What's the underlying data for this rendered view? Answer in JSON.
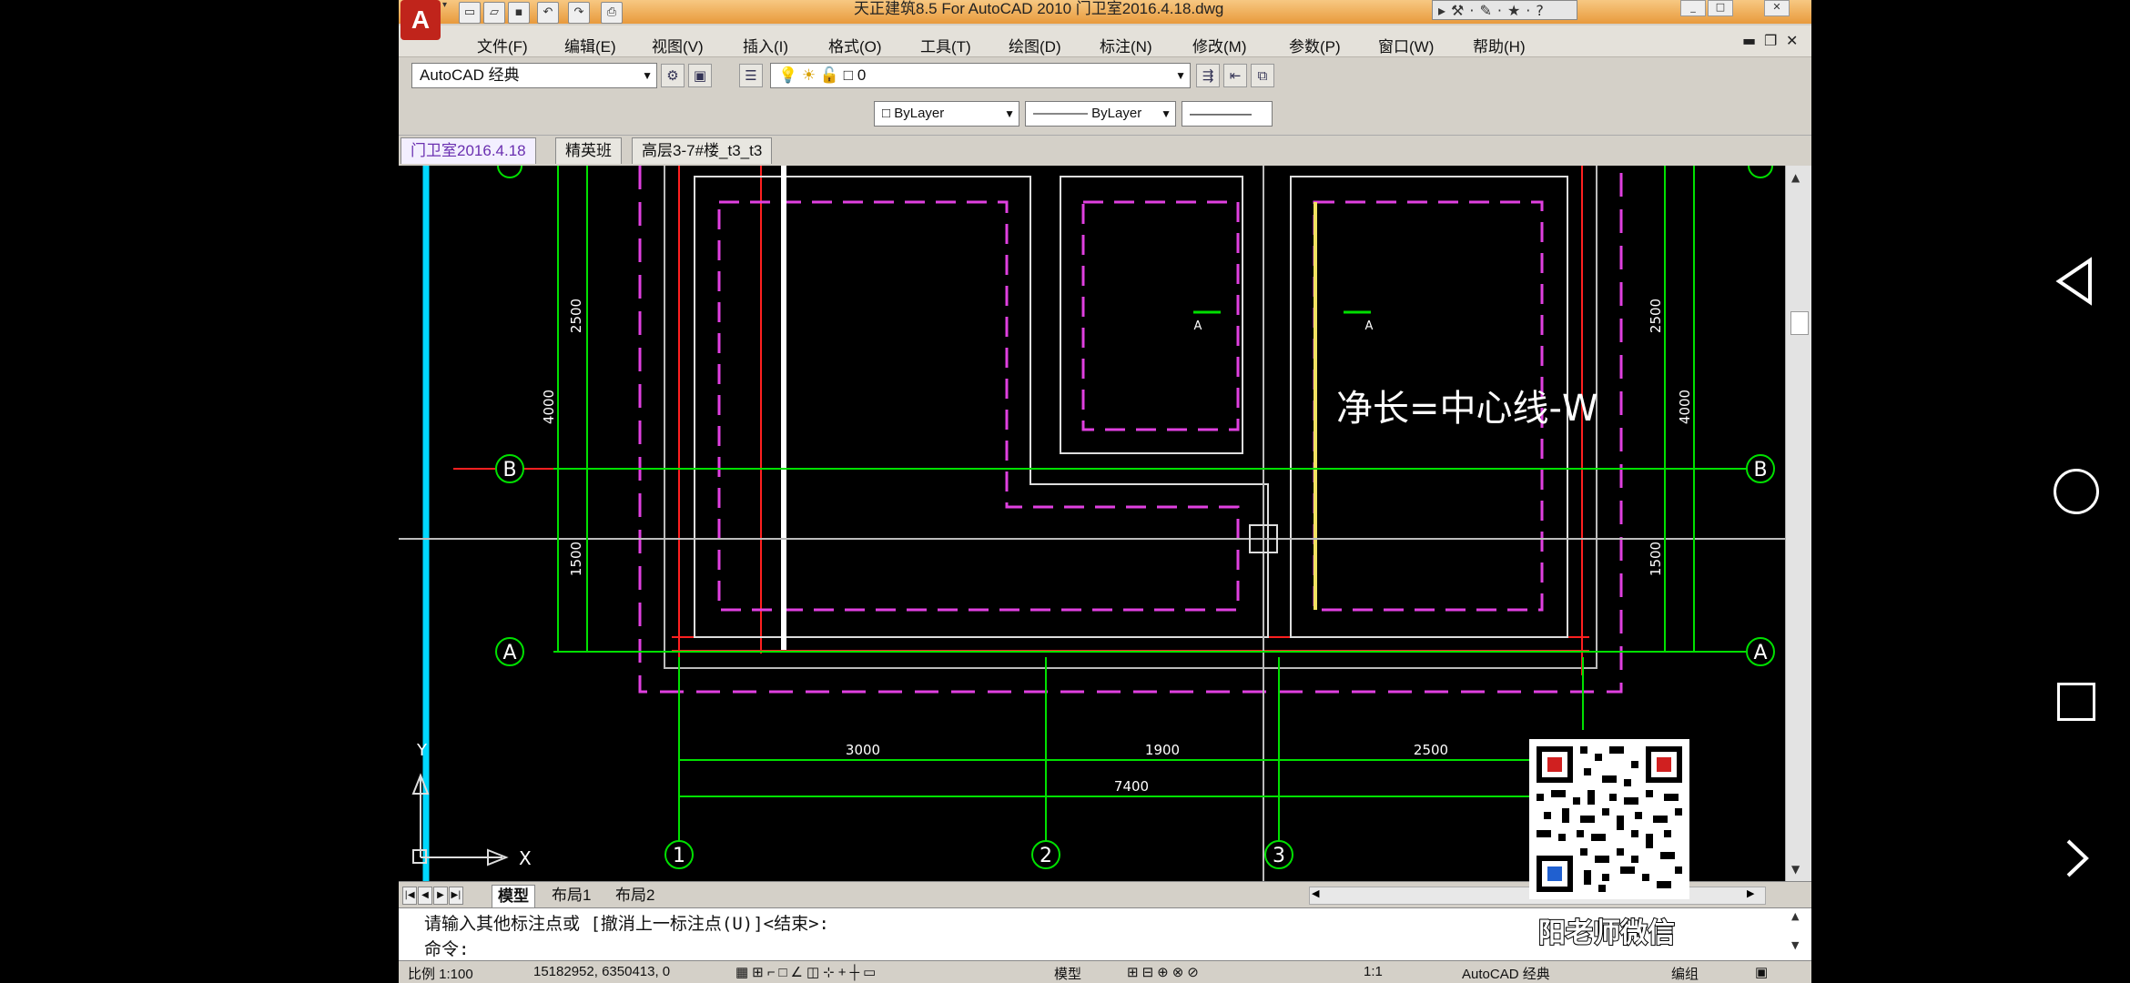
{
  "titlebar": {
    "title": "天正建筑8.5 For AutoCAD 2010        门卫室2016.4.18.dwg",
    "logo": "A",
    "quick_access": [
      "new-icon",
      "open-icon",
      "save-icon",
      "undo-icon",
      "redo-icon",
      "print-icon"
    ]
  },
  "menubar": {
    "items": [
      "文件(F)",
      "编辑(E)",
      "视图(V)",
      "插入(I)",
      "格式(O)",
      "工具(T)",
      "绘图(D)",
      "标注(N)",
      "修改(M)",
      "参数(P)",
      "窗口(W)",
      "帮助(H)"
    ]
  },
  "toolbar": {
    "workspace": "AutoCAD 经典",
    "layer": "0",
    "color": "ByLayer",
    "linetype": "ByLayer"
  },
  "doc_tabs": [
    "门卫室2016.4.18",
    "精英班",
    "高层3-7#楼_t3_t3"
  ],
  "drawing": {
    "axes_h": [
      "B",
      "A"
    ],
    "axes_v": [
      "1",
      "2",
      "3"
    ],
    "dims_left": [
      "2500",
      "4000",
      "1500"
    ],
    "dims_right": [
      "2500",
      "4000",
      "1500"
    ],
    "dims_bottom": [
      "3000",
      "1900",
      "2500"
    ],
    "dim_total": "7400",
    "note": "净长=中心线-W",
    "section_mark": "A",
    "ucs_y": "Y",
    "ucs_x": "X",
    "colors": {
      "axis": "#00e000",
      "wall": "#ffffff",
      "column": "#ff0000",
      "magenta": "#e040e0",
      "accent": "#00d8ff"
    }
  },
  "layout_tabs": [
    "模型",
    "布局1",
    "布局2"
  ],
  "command": {
    "line1": "请输入其他标注点或 [撤消上一标注点(U)]<结束>:",
    "line2": "命令:"
  },
  "status": {
    "scale": "比例 1:100",
    "coords": "15182952, 6350413, 0",
    "model": "模型",
    "anno_scale": "1:1",
    "workspace": "AutoCAD 经典",
    "group": "编组"
  },
  "watermark": "阳老师微信"
}
